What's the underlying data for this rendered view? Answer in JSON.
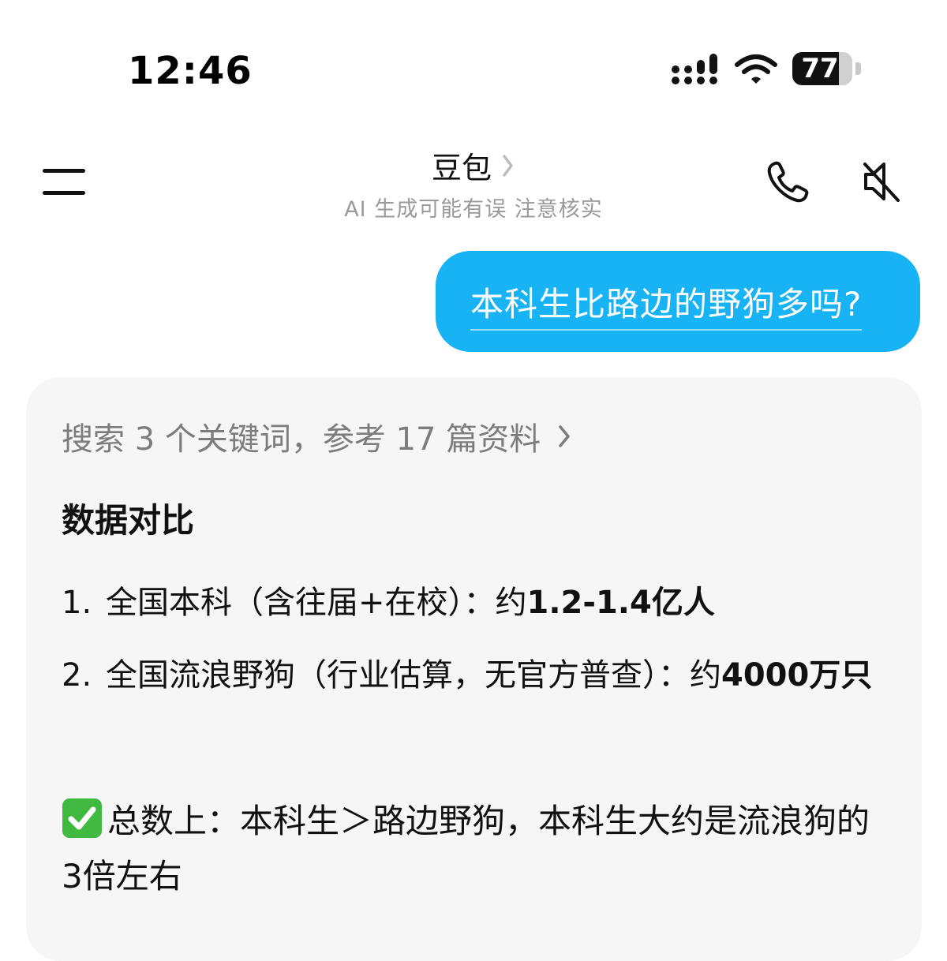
{
  "status_bar": {
    "time": "12:46",
    "battery_level": "77",
    "battery_fraction": 0.77
  },
  "header": {
    "title": "豆包",
    "subtitle": "AI 生成可能有误 注意核实"
  },
  "user_message": {
    "text": "本科生比路边的野狗多吗?"
  },
  "assistant_message": {
    "search_summary": "搜索 3 个关键词，参考 17 篇资料",
    "section_title": "数据对比",
    "items": [
      {
        "num": "1.",
        "label": "全国本科（含往届+在校）：约",
        "value": "1.2-1.4亿人"
      },
      {
        "num": "2.",
        "label": "全国流浪野狗（行业估算，无官方普查）：约",
        "value": "4000万只"
      }
    ],
    "conclusion": "总数上：本科生＞路边野狗，本科生大约是流浪狗的3倍左右"
  },
  "colors": {
    "accent_blue": "#17b3f4",
    "card_background": "#f6f6f6",
    "check_green": "#3fb93f"
  },
  "icons": {
    "menu": "menu-icon",
    "phone": "phone-icon",
    "mute": "speaker-mute-icon",
    "chevron": "chevron-right-icon",
    "check": "check-mark-button-icon"
  }
}
